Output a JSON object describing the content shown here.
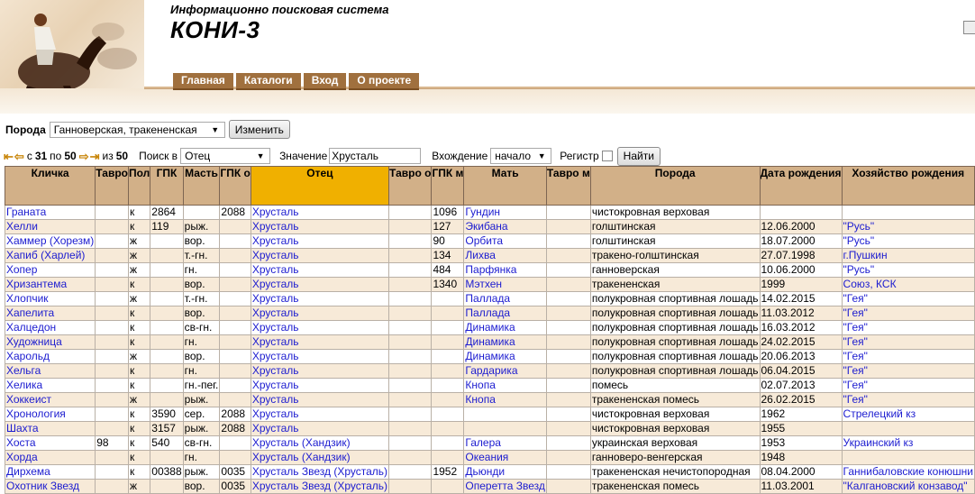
{
  "header": {
    "subtitle": "Информационно поисковая система",
    "title": "КОНИ-3",
    "nav": [
      "Главная",
      "Каталоги",
      "Вход",
      "О проекте"
    ]
  },
  "breed": {
    "label": "Порода",
    "value": "Ганноверская, тракененская",
    "button": "Изменить"
  },
  "pager": {
    "from_label": "с",
    "from": "31",
    "to_label": "по",
    "to": "50",
    "of_label": "из",
    "total": "50"
  },
  "search": {
    "in_label": "Поиск в",
    "in_value": "Отец",
    "value_label": "Значение",
    "value": "Хрусталь",
    "entry_label": "Вхождение",
    "entry_value": "начало",
    "register_label": "Регистр",
    "find_button": "Найти"
  },
  "table": {
    "headers": [
      "Кличка",
      "Тавро",
      "Пол",
      "ГПК",
      "Масть",
      "ГПК о",
      "Отец",
      "Тавро о",
      "ГПК м",
      "Мать",
      "Тавро м",
      "Порода",
      "Дата рождения",
      "Хозяйство рождения"
    ],
    "rows": [
      [
        "Граната",
        "",
        "к",
        "2864",
        "",
        "2088",
        "Хрусталь",
        "",
        "1096",
        "Гундин",
        "",
        "чистокровная верховая",
        "",
        ""
      ],
      [
        "Хелли",
        "",
        "к",
        "119",
        "рыж.",
        "",
        "Хрусталь",
        "",
        "127",
        "Экибана",
        "",
        "голштинская",
        "12.06.2000",
        "\"Русь\""
      ],
      [
        "Хаммер (Хорезм)",
        "",
        "ж",
        "",
        "вор.",
        "",
        "Хрусталь",
        "",
        "90",
        "Орбита",
        "",
        "голштинская",
        "18.07.2000",
        "\"Русь\""
      ],
      [
        "Хапиб (Харлей)",
        "",
        "ж",
        "",
        "т.-гн.",
        "",
        "Хрусталь",
        "",
        "134",
        "Лихва",
        "",
        "тракено-голштинская",
        "27.07.1998",
        "г.Пушкин"
      ],
      [
        "Хопер",
        "",
        "ж",
        "",
        "гн.",
        "",
        "Хрусталь",
        "",
        "484",
        "Парфянка",
        "",
        "ганноверская",
        "10.06.2000",
        "\"Русь\""
      ],
      [
        "Хризантема",
        "",
        "к",
        "",
        "вор.",
        "",
        "Хрусталь",
        "",
        "1340",
        "Мэтхен",
        "",
        "тракененская",
        "1999",
        "Союз, КСК"
      ],
      [
        "Хлопчик",
        "",
        "ж",
        "",
        "т.-гн.",
        "",
        "Хрусталь",
        "",
        "",
        "Паллада",
        "",
        "полукровная спортивная лошадь",
        "14.02.2015",
        "\"Гея\""
      ],
      [
        "Хапелита",
        "",
        "к",
        "",
        "вор.",
        "",
        "Хрусталь",
        "",
        "",
        "Паллада",
        "",
        "полукровная спортивная лошадь",
        "11.03.2012",
        "\"Гея\""
      ],
      [
        "Халцедон",
        "",
        "к",
        "",
        "св-гн.",
        "",
        "Хрусталь",
        "",
        "",
        "Динамика",
        "",
        "полукровная спортивная лошадь",
        "16.03.2012",
        "\"Гея\""
      ],
      [
        "Художница",
        "",
        "к",
        "",
        "гн.",
        "",
        "Хрусталь",
        "",
        "",
        "Динамика",
        "",
        "полукровная спортивная лошадь",
        "24.02.2015",
        "\"Гея\""
      ],
      [
        "Харольд",
        "",
        "ж",
        "",
        "вор.",
        "",
        "Хрусталь",
        "",
        "",
        "Динамика",
        "",
        "полукровная спортивная лошадь",
        "20.06.2013",
        "\"Гея\""
      ],
      [
        "Хельга",
        "",
        "к",
        "",
        "гн.",
        "",
        "Хрусталь",
        "",
        "",
        "Гардарика",
        "",
        "полукровная спортивная лошадь",
        "06.04.2015",
        "\"Гея\""
      ],
      [
        "Хелика",
        "",
        "к",
        "",
        "гн.-пег.",
        "",
        "Хрусталь",
        "",
        "",
        "Кнопа",
        "",
        "помесь",
        "02.07.2013",
        "\"Гея\""
      ],
      [
        "Хоккеист",
        "",
        "ж",
        "",
        "рыж.",
        "",
        "Хрусталь",
        "",
        "",
        "Кнопа",
        "",
        "тракененская помесь",
        "26.02.2015",
        "\"Гея\""
      ],
      [
        "Хронология",
        "",
        "к",
        "3590",
        "сер.",
        "2088",
        "Хрусталь",
        "",
        "",
        "",
        "",
        "чистокровная верховая",
        "1962",
        "Стрелецкий кз"
      ],
      [
        "Шахта",
        "",
        "к",
        "3157",
        "рыж.",
        "2088",
        "Хрусталь",
        "",
        "",
        "",
        "",
        "чистокровная верховая",
        "1955",
        ""
      ],
      [
        "Хоста",
        "98",
        "к",
        "540",
        "св-гн.",
        "",
        "Хрусталь (Хандзик)",
        "",
        "",
        "Галера",
        "",
        "украинская верховая",
        "1953",
        "Украинский кз"
      ],
      [
        "Хорда",
        "",
        "к",
        "",
        "гн.",
        "",
        "Хрусталь (Хандзик)",
        "",
        "",
        "Океания",
        "",
        "ганноверо-венгерская",
        "1948",
        ""
      ],
      [
        "Дирхема",
        "",
        "к",
        "00388",
        "рыж.",
        "0035",
        "Хрусталь Звезд (Хрусталь)",
        "",
        "1952",
        "Дьюнди",
        "",
        "тракененская нечистопородная",
        "08.04.2000",
        "Ганнибаловские конюшни"
      ],
      [
        "Охотник Звезд",
        "",
        "ж",
        "",
        "вор.",
        "0035",
        "Хрусталь Звезд (Хрусталь)",
        "",
        "",
        "Оперетта Звезд",
        "",
        "тракененская помесь",
        "11.03.2001",
        "\"Калгановский конзавод\""
      ]
    ]
  }
}
